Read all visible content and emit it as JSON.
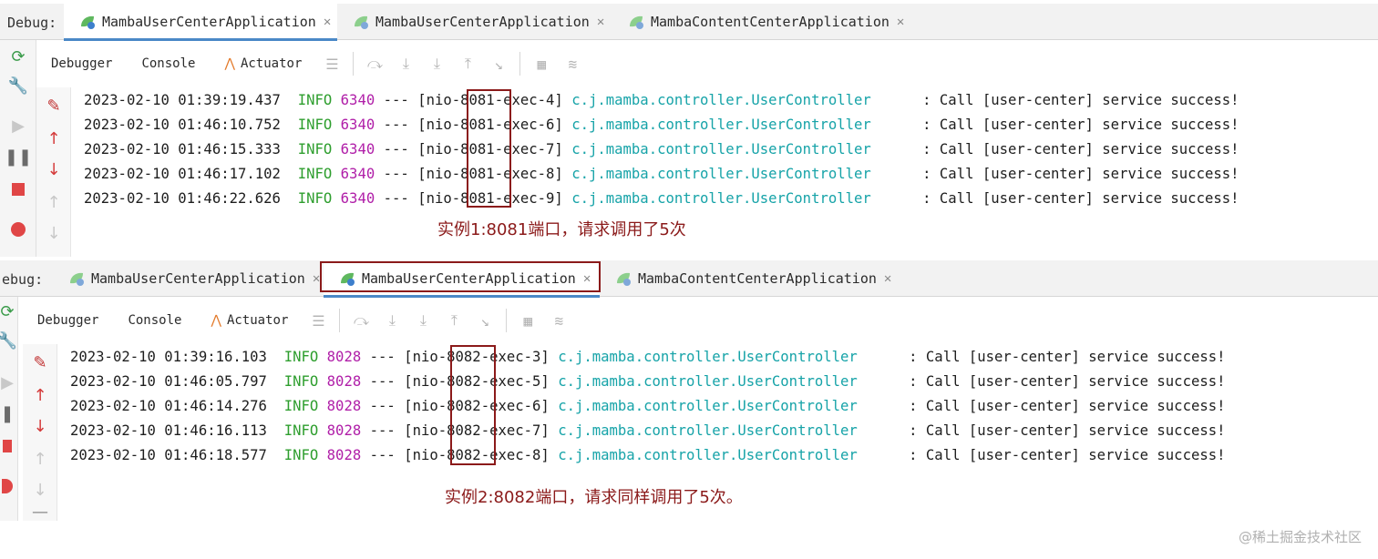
{
  "top": {
    "debug_label": "Debug:",
    "tabs": [
      {
        "label": "MambaUserCenterApplication"
      },
      {
        "label": "MambaUserCenterApplication"
      },
      {
        "label": "MambaContentCenterApplication"
      }
    ],
    "tool_tabs": {
      "debugger": "Debugger",
      "console": "Console",
      "actuator": "Actuator"
    },
    "logs": [
      {
        "ts": "2023-02-10 01:39:19.437",
        "level": "INFO",
        "pid": "6340",
        "sep": "---",
        "thread_pre": "[nio-",
        "port": "8081",
        "thread_post": "-exec-4]",
        "cls": "c.j.mamba.controller.UserController",
        "msg": ": Call [user-center] service success!"
      },
      {
        "ts": "2023-02-10 01:46:10.752",
        "level": "INFO",
        "pid": "6340",
        "sep": "---",
        "thread_pre": "[nio-",
        "port": "8081",
        "thread_post": "-exec-6]",
        "cls": "c.j.mamba.controller.UserController",
        "msg": ": Call [user-center] service success!"
      },
      {
        "ts": "2023-02-10 01:46:15.333",
        "level": "INFO",
        "pid": "6340",
        "sep": "---",
        "thread_pre": "[nio-",
        "port": "8081",
        "thread_post": "-exec-7]",
        "cls": "c.j.mamba.controller.UserController",
        "msg": ": Call [user-center] service success!"
      },
      {
        "ts": "2023-02-10 01:46:17.102",
        "level": "INFO",
        "pid": "6340",
        "sep": "---",
        "thread_pre": "[nio-",
        "port": "8081",
        "thread_post": "-exec-8]",
        "cls": "c.j.mamba.controller.UserController",
        "msg": ": Call [user-center] service success!"
      },
      {
        "ts": "2023-02-10 01:46:22.626",
        "level": "INFO",
        "pid": "6340",
        "sep": "---",
        "thread_pre": "[nio-",
        "port": "8081",
        "thread_post": "-exec-9]",
        "cls": "c.j.mamba.controller.UserController",
        "msg": ": Call [user-center] service success!"
      }
    ],
    "note": "实例1:8081端口，请求调用了5次"
  },
  "bottom": {
    "debug_label": "ebug:",
    "tabs": [
      {
        "label": "MambaUserCenterApplication"
      },
      {
        "label": "MambaUserCenterApplication"
      },
      {
        "label": "MambaContentCenterApplication"
      }
    ],
    "tool_tabs": {
      "debugger": "Debugger",
      "console": "Console",
      "actuator": "Actuator"
    },
    "logs": [
      {
        "ts": "2023-02-10 01:39:16.103",
        "level": "INFO",
        "pid": "8028",
        "sep": "---",
        "thread_pre": "[nio-",
        "port": "8082",
        "thread_post": "-exec-3]",
        "cls": "c.j.mamba.controller.UserController",
        "msg": ": Call [user-center] service success!"
      },
      {
        "ts": "2023-02-10 01:46:05.797",
        "level": "INFO",
        "pid": "8028",
        "sep": "---",
        "thread_pre": "[nio-",
        "port": "8082",
        "thread_post": "-exec-5]",
        "cls": "c.j.mamba.controller.UserController",
        "msg": ": Call [user-center] service success!"
      },
      {
        "ts": "2023-02-10 01:46:14.276",
        "level": "INFO",
        "pid": "8028",
        "sep": "---",
        "thread_pre": "[nio-",
        "port": "8082",
        "thread_post": "-exec-6]",
        "cls": "c.j.mamba.controller.UserController",
        "msg": ": Call [user-center] service success!"
      },
      {
        "ts": "2023-02-10 01:46:16.113",
        "level": "INFO",
        "pid": "8028",
        "sep": "---",
        "thread_pre": "[nio-",
        "port": "8082",
        "thread_post": "-exec-7]",
        "cls": "c.j.mamba.controller.UserController",
        "msg": ": Call [user-center] service success!"
      },
      {
        "ts": "2023-02-10 01:46:18.577",
        "level": "INFO",
        "pid": "8028",
        "sep": "---",
        "thread_pre": "[nio-",
        "port": "8082",
        "thread_post": "-exec-8]",
        "cls": "c.j.mamba.controller.UserController",
        "msg": ": Call [user-center] service success!"
      }
    ],
    "note": "实例2:8082端口，请求同样调用了5次。"
  },
  "watermark": "@稀土掘金技术社区",
  "colors": {
    "info": "#2e9e2e",
    "pid": "#b01ea8",
    "class": "#16a3a8",
    "annotation": "#8b1a1a",
    "active_tab_underline": "#4a88c7"
  },
  "icons": [
    "rerun-icon",
    "wrench-icon",
    "resume-icon",
    "pause-icon",
    "stop-icon",
    "breakpoints-icon",
    "clear-icon",
    "up-arrow-icon",
    "down-arrow-icon",
    "app-leaf-icon",
    "close-icon",
    "actuator-icon",
    "menu-icon",
    "step-over-icon",
    "step-into-icon",
    "force-step-into-icon",
    "step-out-icon",
    "run-to-cursor-icon",
    "evaluate-icon",
    "trace-icon"
  ]
}
